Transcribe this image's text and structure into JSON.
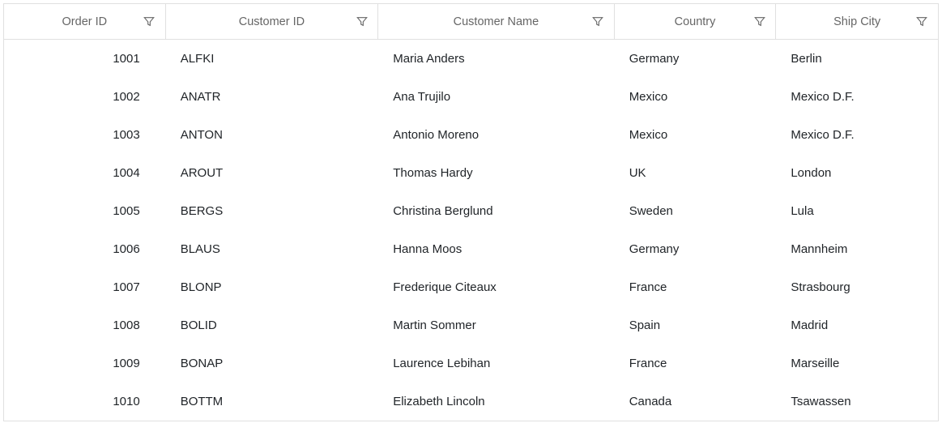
{
  "grid": {
    "columns": [
      {
        "label": "Order ID"
      },
      {
        "label": "Customer ID"
      },
      {
        "label": "Customer Name"
      },
      {
        "label": "Country"
      },
      {
        "label": "Ship City"
      }
    ],
    "rows": [
      {
        "order_id": "1001",
        "customer_id": "ALFKI",
        "customer_name": "Maria Anders",
        "country": "Germany",
        "ship_city": "Berlin"
      },
      {
        "order_id": "1002",
        "customer_id": "ANATR",
        "customer_name": "Ana Trujilo",
        "country": "Mexico",
        "ship_city": "Mexico D.F."
      },
      {
        "order_id": "1003",
        "customer_id": "ANTON",
        "customer_name": "Antonio Moreno",
        "country": "Mexico",
        "ship_city": "Mexico D.F."
      },
      {
        "order_id": "1004",
        "customer_id": "AROUT",
        "customer_name": "Thomas Hardy",
        "country": "UK",
        "ship_city": "London"
      },
      {
        "order_id": "1005",
        "customer_id": "BERGS",
        "customer_name": "Christina Berglund",
        "country": "Sweden",
        "ship_city": "Lula"
      },
      {
        "order_id": "1006",
        "customer_id": "BLAUS",
        "customer_name": "Hanna Moos",
        "country": "Germany",
        "ship_city": "Mannheim"
      },
      {
        "order_id": "1007",
        "customer_id": "BLONP",
        "customer_name": "Frederique Citeaux",
        "country": "France",
        "ship_city": "Strasbourg"
      },
      {
        "order_id": "1008",
        "customer_id": "BOLID",
        "customer_name": "Martin Sommer",
        "country": "Spain",
        "ship_city": "Madrid"
      },
      {
        "order_id": "1009",
        "customer_id": "BONAP",
        "customer_name": "Laurence Lebihan",
        "country": "France",
        "ship_city": "Marseille"
      },
      {
        "order_id": "1010",
        "customer_id": "BOTTM",
        "customer_name": "Elizabeth Lincoln",
        "country": "Canada",
        "ship_city": "Tsawassen"
      }
    ]
  }
}
